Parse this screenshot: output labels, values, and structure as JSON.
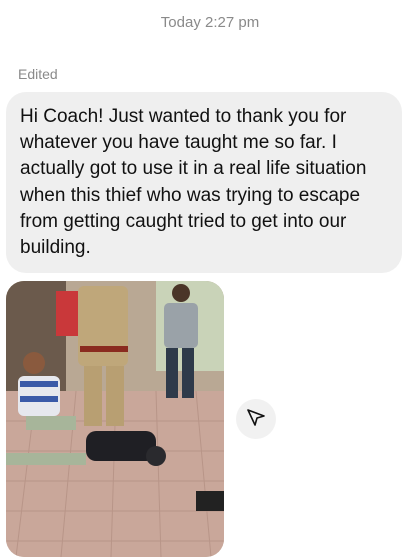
{
  "conversation": {
    "timestamp": "Today 2:27 pm",
    "edited_label": "Edited",
    "message_text": "Hi Coach! Just wanted to thank you for whatever you have taught me so far. I actually got to use it in a real life situation when this thief who was trying to escape from getting caught tried to get into our building."
  },
  "attachment": {
    "type": "photo",
    "description_icon": "photo-attachment"
  },
  "actions": {
    "share_icon": "share-icon"
  },
  "colors": {
    "bubble_bg": "#efefef",
    "meta_text": "#8a8a8a",
    "message_text": "#111111"
  }
}
